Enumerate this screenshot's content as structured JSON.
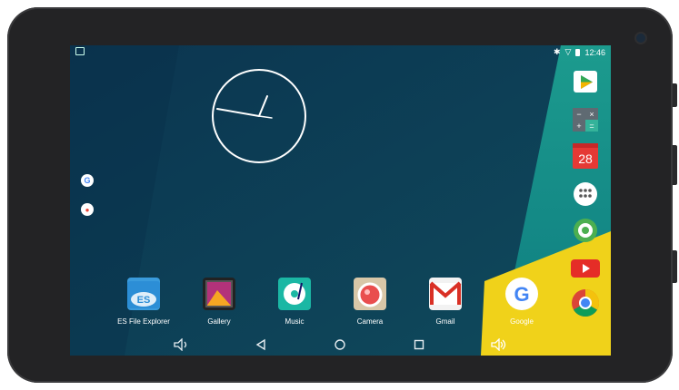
{
  "status_bar": {
    "time": "12:46",
    "icons": [
      "picture-notification-icon",
      "bluetooth-icon",
      "wifi-icon",
      "battery-icon"
    ]
  },
  "left_shortcuts": [
    "google-search-icon",
    "voice-search-icon"
  ],
  "dock": [
    {
      "label": "ES File Explorer",
      "icon": "es-file-explorer-icon"
    },
    {
      "label": "Gallery",
      "icon": "gallery-icon"
    },
    {
      "label": "Music",
      "icon": "music-icon"
    },
    {
      "label": "Camera",
      "icon": "camera-icon"
    },
    {
      "label": "Gmail",
      "icon": "gmail-icon"
    },
    {
      "label": "Google",
      "icon": "google-icon"
    }
  ],
  "right_column": [
    {
      "icon": "play-store-icon"
    },
    {
      "icon": "calculator-icon"
    },
    {
      "icon": "calendar-icon",
      "text": "28"
    },
    {
      "icon": "app-drawer-icon"
    },
    {
      "icon": "settings-icon"
    },
    {
      "icon": "youtube-icon"
    },
    {
      "icon": "chrome-icon"
    }
  ],
  "navigation": [
    "volume-down-icon",
    "back-icon",
    "home-icon",
    "recents-icon",
    "volume-up-icon"
  ],
  "colors": {
    "wallpaper_dark": "#0d3b52",
    "wallpaper_teal": "#12857f",
    "wallpaper_yellow": "#f0d21a",
    "bezel": "#232325"
  }
}
